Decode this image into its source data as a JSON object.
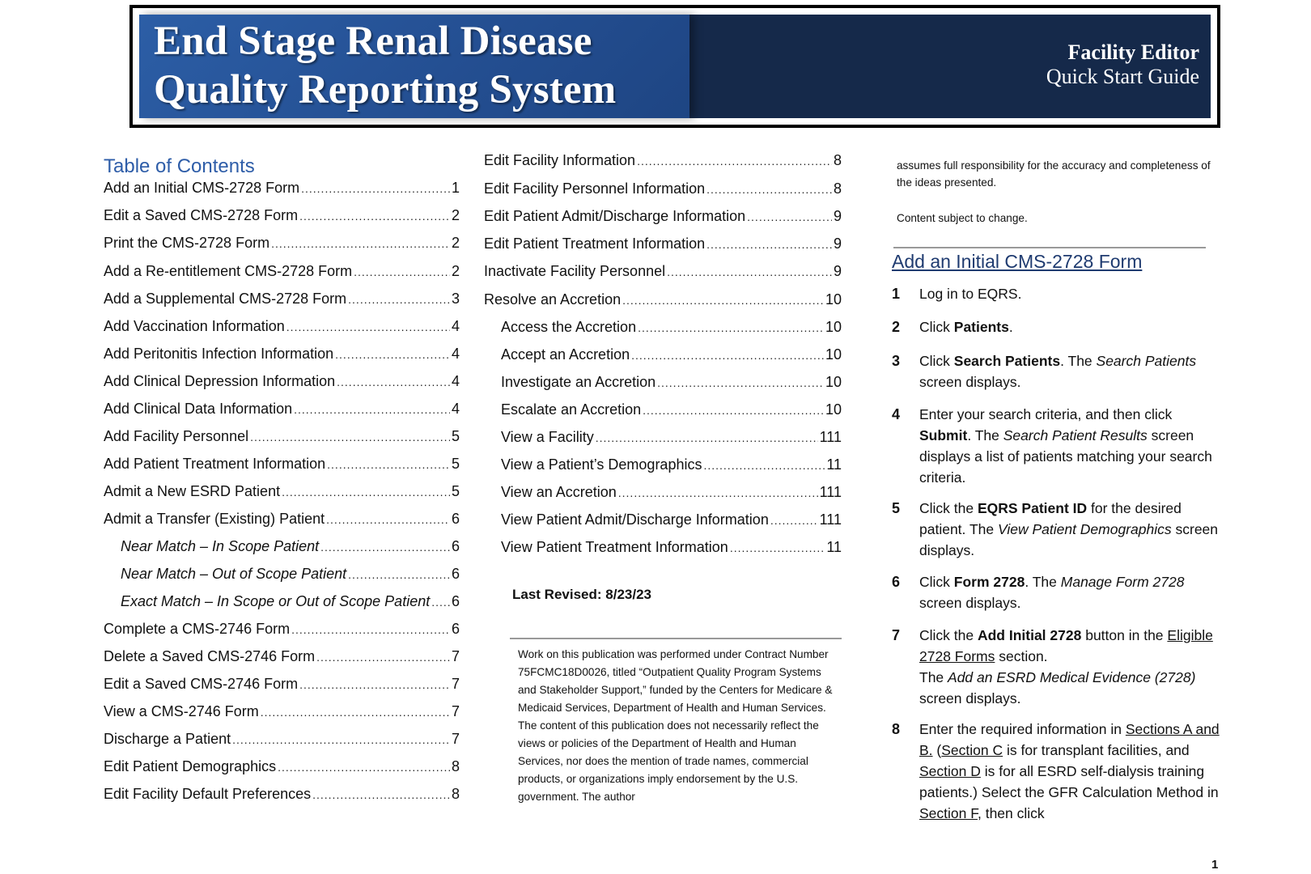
{
  "banner": {
    "title_line1": "End Stage Renal Disease",
    "title_line2": "Quality Reporting System",
    "subtitle_line1": "Facility Editor",
    "subtitle_line2": "Quick Start Guide"
  },
  "toc": {
    "heading": "Table of Contents",
    "left": [
      {
        "title": "Add an Initial CMS-2728 Form",
        "page": "1"
      },
      {
        "title": "Edit a Saved CMS-2728 Form",
        "page": "2"
      },
      {
        "title": "Print the CMS-2728 Form",
        "page": "2"
      },
      {
        "title": "Add a Re-entitlement CMS-2728 Form",
        "page": "2"
      },
      {
        "title": "Add a Supplemental CMS-2728 Form",
        "page": "3"
      },
      {
        "title": "Add Vaccination Information",
        "page": "4"
      },
      {
        "title": "Add Peritonitis Infection Information",
        "page": "4"
      },
      {
        "title": "Add Clinical Depression Information",
        "page": "4"
      },
      {
        "title": "Add Clinical Data Information",
        "page": "4"
      },
      {
        "title": "Add Facility Personnel",
        "page": "5"
      },
      {
        "title": "Add Patient Treatment Information",
        "page": "5"
      },
      {
        "title": "Admit a New ESRD Patient",
        "page": "5"
      },
      {
        "title": "Admit a Transfer (Existing) Patient",
        "page": "6"
      },
      {
        "title": "Near Match – In Scope Patient",
        "page": "6"
      },
      {
        "title": "Near Match – Out of Scope Patient",
        "page": "6"
      },
      {
        "title": "Exact Match – In Scope or Out of  Scope Patient",
        "page": "6"
      },
      {
        "title": "Complete a CMS-2746 Form",
        "page": "6"
      },
      {
        "title": "Delete a Saved CMS-2746 Form",
        "page": "7"
      },
      {
        "title": "Edit a Saved CMS-2746 Form",
        "page": "7"
      },
      {
        "title": "View a CMS-2746 Form",
        "page": "7"
      },
      {
        "title": "Discharge a Patient",
        "page": "7"
      },
      {
        "title": "Edit Patient Demographics",
        "page": "8"
      },
      {
        "title": "Edit Facility Default Preferences",
        "page": "8"
      }
    ],
    "middle": [
      {
        "title": "Edit Facility Information",
        "page": "8"
      },
      {
        "title": "Edit Facility Personnel Information",
        "page": "8"
      },
      {
        "title": "Edit Patient Admit/Discharge Information",
        "page": "9"
      },
      {
        "title": "Edit Patient Treatment Information",
        "page": "9"
      },
      {
        "title": "Inactivate Facility Personnel",
        "page": "9"
      },
      {
        "title": "Resolve an Accretion",
        "page": "10"
      },
      {
        "title": "Access the Accretion",
        "page": "10"
      },
      {
        "title": "Accept an Accretion",
        "page": "10"
      },
      {
        "title": "Investigate an Accretion",
        "page": "10"
      },
      {
        "title": "Escalate an Accretion",
        "page": "10"
      },
      {
        "title": "View a Facility",
        "page": "111"
      },
      {
        "title": "View a Patient’s Demographics",
        "page": "11"
      },
      {
        "title": "View an Accretion",
        "page": "111"
      },
      {
        "title": "View Patient Admit/Discharge Information",
        "page": "111"
      },
      {
        "title": "View Patient Treatment Information",
        "page": "11"
      }
    ]
  },
  "last_revised": "Last Revised: 8/23/23",
  "disclaimer": "Work on this publication was performed under Contract Number 75FCMC18D0026, titled “Outpatient Quality Program Systems and Stakeholder Support,” funded by the Centers for Medicare & Medicaid Services, Department of Health and Human Services. The content of this publication does not necessarily reflect the views or policies of the Department of Health and Human Services, nor does the mention of trade names, commercial products, or organizations imply endorsement by the U.S. government. The author",
  "right": {
    "continued": "assumes full responsibility for the accuracy and completeness of the ideas presented.",
    "change_note": "Content subject to change.",
    "section_heading": "Add an Initial CMS-2728 Form",
    "steps": {
      "s1": {
        "num": "1",
        "a": "Log in to EQRS."
      },
      "s2": {
        "num": "2",
        "a": "Click ",
        "b": "Patients",
        "c": "."
      },
      "s3": {
        "num": "3",
        "a": "Click ",
        "b": "Search Patients",
        "c": ". The ",
        "d": "Search Patients",
        "e": " screen displays."
      },
      "s4": {
        "num": "4",
        "a": "Enter your search criteria, and then click ",
        "b": "Submit",
        "c": ". The ",
        "d": "Search Patient Results",
        "e": " screen displays a list of patients matching your search criteria."
      },
      "s5": {
        "num": "5",
        "a": "Click the ",
        "b": "EQRS Patient ID",
        "c": " for the desired patient. The ",
        "d": "View Patient Demographics",
        "e": " screen displays."
      },
      "s6": {
        "num": "6",
        "a": "Click ",
        "b": "Form 2728",
        "c": ". The ",
        "d": "Manage Form 2728",
        "e": " screen displays."
      },
      "s7": {
        "num": "7",
        "a": "Click the ",
        "b": "Add Initial 2728",
        "c": " button in the ",
        "d": "Eligible 2728 Forms",
        "e": " section.",
        "f": "The ",
        "g": "Add an ESRD Medical Evidence (2728)",
        "h": " screen displays."
      },
      "s8": {
        "num": "8",
        "a": "Enter the required information in ",
        "b": "Sections A and B.",
        "c": " (",
        "d": "Section C",
        "e": " is for transplant facilities, and ",
        "f": "Section D",
        "g": " is for all ESRD self-dialysis training patients.) Select the GFR Calculation Method in ",
        "h": "Section F",
        "i": ", then click"
      }
    }
  },
  "page_number": "1"
}
